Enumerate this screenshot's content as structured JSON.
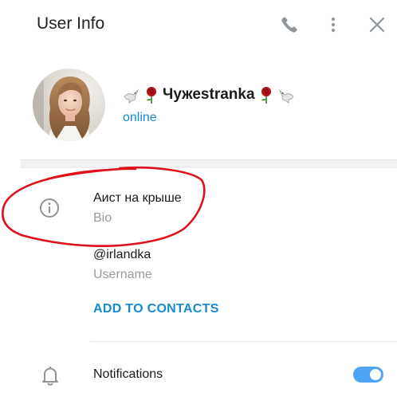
{
  "header": {
    "title": "User Info",
    "icons": [
      "phone-icon",
      "more-vertical-icon",
      "close-icon"
    ]
  },
  "profile": {
    "name": "Чужеstranka",
    "status": "online",
    "name_decorations": [
      "dove-emoji",
      "rose-emoji"
    ]
  },
  "info": {
    "bio": {
      "value": "Аист на крыше",
      "label": "Bio"
    },
    "username": {
      "value": "@irlandka",
      "label": "Username"
    },
    "add_contact_label": "ADD TO CONTACTS"
  },
  "notifications": {
    "label": "Notifications",
    "enabled": true
  },
  "colors": {
    "accent": "#168acd",
    "toggle": "#4ea4f6",
    "annotation": "#e0101a",
    "muted_text": "#9a9a9a",
    "icon": "#8f959a"
  }
}
